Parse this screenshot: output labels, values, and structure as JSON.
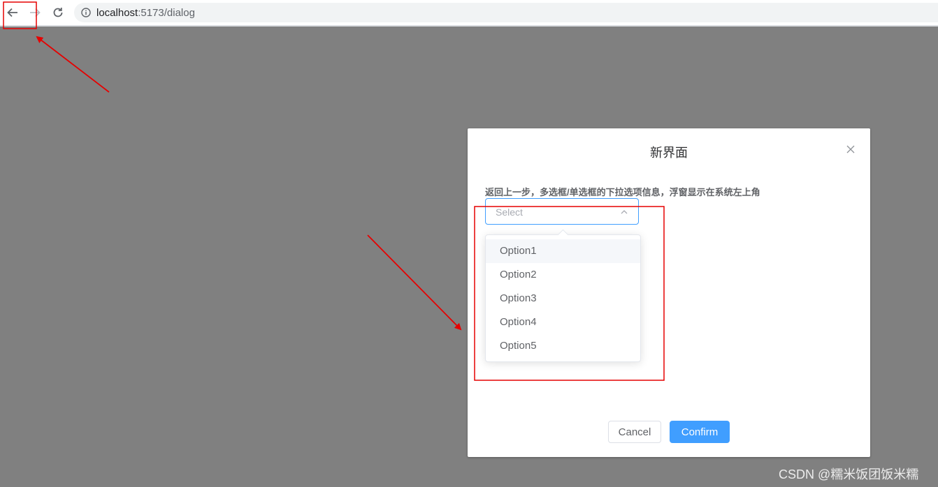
{
  "browser": {
    "url_host": "localhost",
    "url_path": ":5173/dialog",
    "back_icon": "arrow-left-icon",
    "forward_icon": "arrow-right-icon",
    "reload_icon": "reload-icon",
    "info_icon": "info-icon"
  },
  "dialog": {
    "title": "新界面",
    "close_icon": "close-icon",
    "field_label": "返回上一步，多选框/单选框的下拉选项信息，浮窗显示在系统左上角",
    "select": {
      "placeholder": "Select",
      "arrow_icon": "chevron-up-icon"
    },
    "options": [
      "Option1",
      "Option2",
      "Option3",
      "Option4",
      "Option5"
    ],
    "hovered_option": "Option1",
    "cancel_label": "Cancel",
    "confirm_label": "Confirm"
  },
  "watermark": "CSDN @糯米饭团饭米糯",
  "colors": {
    "overlay": "#808080",
    "primary": "#409eff",
    "annotation": "#e60000"
  }
}
